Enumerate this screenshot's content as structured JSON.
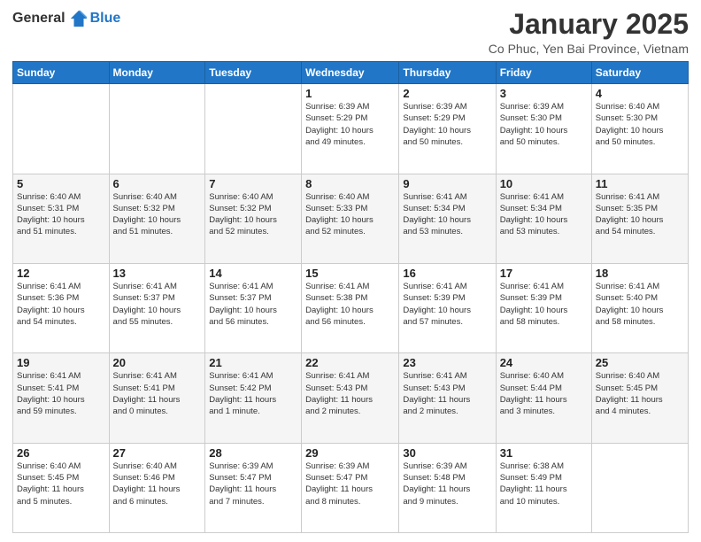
{
  "header": {
    "logo_general": "General",
    "logo_blue": "Blue",
    "title": "January 2025",
    "subtitle": "Co Phuc, Yen Bai Province, Vietnam"
  },
  "days_of_week": [
    "Sunday",
    "Monday",
    "Tuesday",
    "Wednesday",
    "Thursday",
    "Friday",
    "Saturday"
  ],
  "weeks": [
    [
      {
        "day": "",
        "info": ""
      },
      {
        "day": "",
        "info": ""
      },
      {
        "day": "",
        "info": ""
      },
      {
        "day": "1",
        "info": "Sunrise: 6:39 AM\nSunset: 5:29 PM\nDaylight: 10 hours\nand 49 minutes."
      },
      {
        "day": "2",
        "info": "Sunrise: 6:39 AM\nSunset: 5:29 PM\nDaylight: 10 hours\nand 50 minutes."
      },
      {
        "day": "3",
        "info": "Sunrise: 6:39 AM\nSunset: 5:30 PM\nDaylight: 10 hours\nand 50 minutes."
      },
      {
        "day": "4",
        "info": "Sunrise: 6:40 AM\nSunset: 5:30 PM\nDaylight: 10 hours\nand 50 minutes."
      }
    ],
    [
      {
        "day": "5",
        "info": "Sunrise: 6:40 AM\nSunset: 5:31 PM\nDaylight: 10 hours\nand 51 minutes."
      },
      {
        "day": "6",
        "info": "Sunrise: 6:40 AM\nSunset: 5:32 PM\nDaylight: 10 hours\nand 51 minutes."
      },
      {
        "day": "7",
        "info": "Sunrise: 6:40 AM\nSunset: 5:32 PM\nDaylight: 10 hours\nand 52 minutes."
      },
      {
        "day": "8",
        "info": "Sunrise: 6:40 AM\nSunset: 5:33 PM\nDaylight: 10 hours\nand 52 minutes."
      },
      {
        "day": "9",
        "info": "Sunrise: 6:41 AM\nSunset: 5:34 PM\nDaylight: 10 hours\nand 53 minutes."
      },
      {
        "day": "10",
        "info": "Sunrise: 6:41 AM\nSunset: 5:34 PM\nDaylight: 10 hours\nand 53 minutes."
      },
      {
        "day": "11",
        "info": "Sunrise: 6:41 AM\nSunset: 5:35 PM\nDaylight: 10 hours\nand 54 minutes."
      }
    ],
    [
      {
        "day": "12",
        "info": "Sunrise: 6:41 AM\nSunset: 5:36 PM\nDaylight: 10 hours\nand 54 minutes."
      },
      {
        "day": "13",
        "info": "Sunrise: 6:41 AM\nSunset: 5:37 PM\nDaylight: 10 hours\nand 55 minutes."
      },
      {
        "day": "14",
        "info": "Sunrise: 6:41 AM\nSunset: 5:37 PM\nDaylight: 10 hours\nand 56 minutes."
      },
      {
        "day": "15",
        "info": "Sunrise: 6:41 AM\nSunset: 5:38 PM\nDaylight: 10 hours\nand 56 minutes."
      },
      {
        "day": "16",
        "info": "Sunrise: 6:41 AM\nSunset: 5:39 PM\nDaylight: 10 hours\nand 57 minutes."
      },
      {
        "day": "17",
        "info": "Sunrise: 6:41 AM\nSunset: 5:39 PM\nDaylight: 10 hours\nand 58 minutes."
      },
      {
        "day": "18",
        "info": "Sunrise: 6:41 AM\nSunset: 5:40 PM\nDaylight: 10 hours\nand 58 minutes."
      }
    ],
    [
      {
        "day": "19",
        "info": "Sunrise: 6:41 AM\nSunset: 5:41 PM\nDaylight: 10 hours\nand 59 minutes."
      },
      {
        "day": "20",
        "info": "Sunrise: 6:41 AM\nSunset: 5:41 PM\nDaylight: 11 hours\nand 0 minutes."
      },
      {
        "day": "21",
        "info": "Sunrise: 6:41 AM\nSunset: 5:42 PM\nDaylight: 11 hours\nand 1 minute."
      },
      {
        "day": "22",
        "info": "Sunrise: 6:41 AM\nSunset: 5:43 PM\nDaylight: 11 hours\nand 2 minutes."
      },
      {
        "day": "23",
        "info": "Sunrise: 6:41 AM\nSunset: 5:43 PM\nDaylight: 11 hours\nand 2 minutes."
      },
      {
        "day": "24",
        "info": "Sunrise: 6:40 AM\nSunset: 5:44 PM\nDaylight: 11 hours\nand 3 minutes."
      },
      {
        "day": "25",
        "info": "Sunrise: 6:40 AM\nSunset: 5:45 PM\nDaylight: 11 hours\nand 4 minutes."
      }
    ],
    [
      {
        "day": "26",
        "info": "Sunrise: 6:40 AM\nSunset: 5:45 PM\nDaylight: 11 hours\nand 5 minutes."
      },
      {
        "day": "27",
        "info": "Sunrise: 6:40 AM\nSunset: 5:46 PM\nDaylight: 11 hours\nand 6 minutes."
      },
      {
        "day": "28",
        "info": "Sunrise: 6:39 AM\nSunset: 5:47 PM\nDaylight: 11 hours\nand 7 minutes."
      },
      {
        "day": "29",
        "info": "Sunrise: 6:39 AM\nSunset: 5:47 PM\nDaylight: 11 hours\nand 8 minutes."
      },
      {
        "day": "30",
        "info": "Sunrise: 6:39 AM\nSunset: 5:48 PM\nDaylight: 11 hours\nand 9 minutes."
      },
      {
        "day": "31",
        "info": "Sunrise: 6:38 AM\nSunset: 5:49 PM\nDaylight: 11 hours\nand 10 minutes."
      },
      {
        "day": "",
        "info": ""
      }
    ]
  ]
}
